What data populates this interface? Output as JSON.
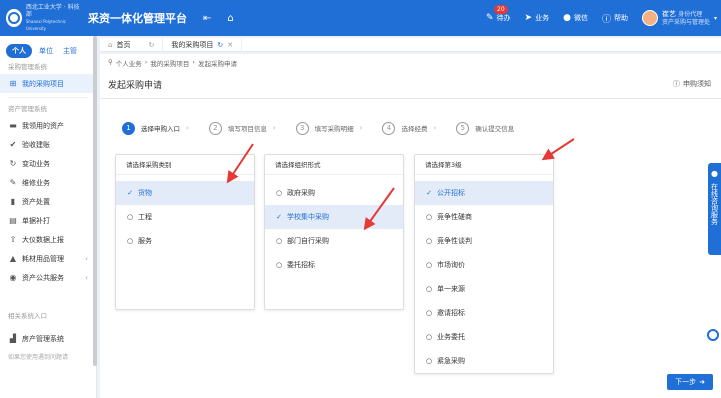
{
  "header": {
    "logo_text_line1": "西北工业大学 · 科技部",
    "logo_text_line2": "Shaanxi Polytechnic University",
    "system_title": "采资一体化管理平台",
    "todo_label": "待办",
    "todo_count": "20",
    "business_label": "业务",
    "wechat_label": "微信",
    "help_label": "帮助",
    "user_name": "崔艺",
    "user_identity": "身份代理",
    "user_dept": "资产采购与管理处"
  },
  "sidebar": {
    "tabs": [
      "个人",
      "单位",
      "主管"
    ],
    "group1": "采购管理系统",
    "group1_items": [
      {
        "label": "我的采购项目"
      }
    ],
    "group2": "资产管理系统",
    "group2_items": [
      {
        "label": "我领用的资产"
      },
      {
        "label": "验收建账"
      },
      {
        "label": "变动业务"
      },
      {
        "label": "维修业务"
      },
      {
        "label": "资产处置"
      },
      {
        "label": "单据补打"
      },
      {
        "label": "大仪数据上报"
      },
      {
        "label": "耗材用品管理"
      },
      {
        "label": "资产公共服务"
      }
    ],
    "group3": "相关系统入口",
    "group3_items": [
      {
        "label": "房产管理系统"
      }
    ],
    "footer": "如果您使用遇到问题请"
  },
  "tabbar": {
    "home": "首页",
    "current": "我的采购项目"
  },
  "main": {
    "breadcrumb": [
      "个人业务",
      "我的采购项目",
      "发起采购申请"
    ],
    "page_title": "发起采购申请",
    "help": "申购须知",
    "steps": [
      {
        "num": "1",
        "label": "选择申购入口"
      },
      {
        "num": "2",
        "label": "填写项目信息"
      },
      {
        "num": "3",
        "label": "填写采购明细"
      },
      {
        "num": "4",
        "label": "选择经费"
      },
      {
        "num": "5",
        "label": "确认提交信息"
      }
    ],
    "panel1": {
      "title": "请选择采购类别",
      "options": [
        "货物",
        "工程",
        "服务"
      ],
      "selected_index": 0
    },
    "panel2": {
      "title": "请选择组织形式",
      "options": [
        "政府采购",
        "学校集中采购",
        "部门自行采购",
        "委托招标"
      ],
      "selected_index": 1
    },
    "panel3": {
      "title": "请选择第3级",
      "options": [
        "公开招标",
        "竞争性磋商",
        "竞争性谈判",
        "市场询价",
        "单一来源",
        "邀请招标",
        "业务委托",
        "紧急采购"
      ],
      "selected_index": 0
    },
    "next_button": "下一步",
    "float_text": "在线咨询服务"
  },
  "colors": {
    "primary": "#1f6fd6",
    "arrow": "#e53935",
    "selected_row": "#e2ebf7"
  }
}
